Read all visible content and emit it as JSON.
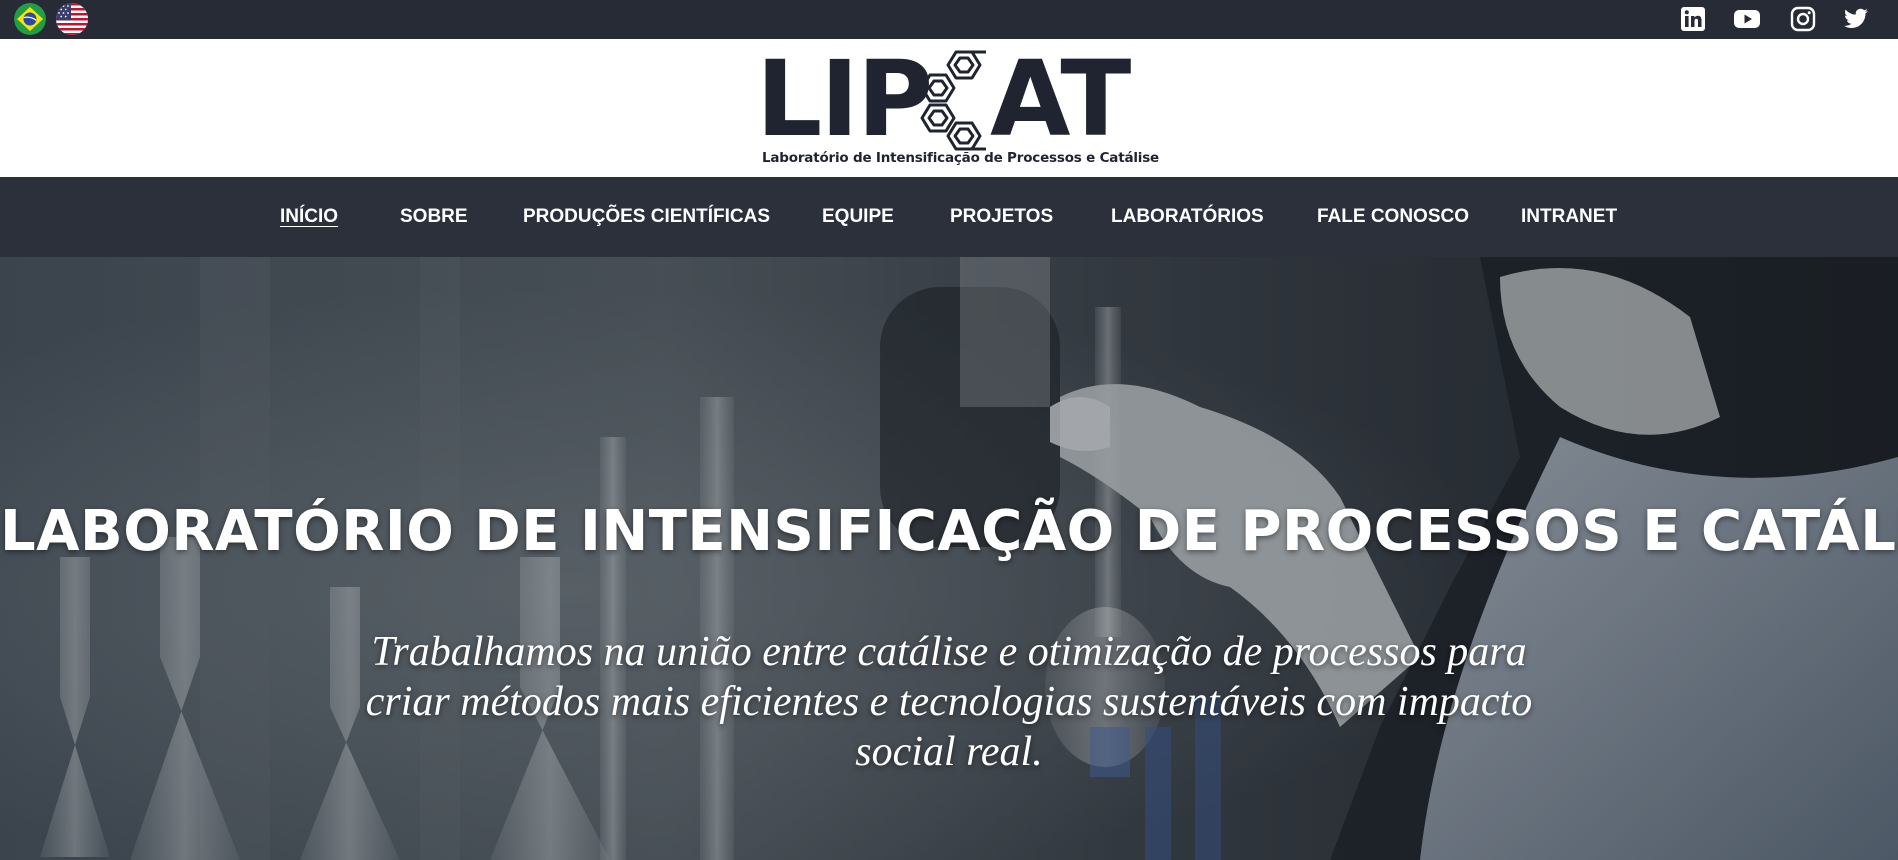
{
  "topbar": {
    "flags": [
      {
        "name": "Português (Brasil)",
        "icon": "brazil-flag-icon"
      },
      {
        "name": "English (US)",
        "icon": "usa-flag-icon"
      }
    ],
    "social": [
      {
        "icon": "linkedin-icon"
      },
      {
        "icon": "youtube-icon"
      },
      {
        "icon": "instagram-icon"
      },
      {
        "icon": "twitter-icon"
      }
    ]
  },
  "logo": {
    "part1": "LIP",
    "part2": "AT",
    "tagline": "Laboratório de Intensificação de Processos e Catálise"
  },
  "nav": {
    "items": [
      {
        "label": "INÍCIO",
        "active": true
      },
      {
        "label": "SOBRE"
      },
      {
        "label": "PRODUÇÕES CIENTÍFICAS"
      },
      {
        "label": "EQUIPE"
      },
      {
        "label": "PROJETOS"
      },
      {
        "label": "LABORATÓRIOS"
      },
      {
        "label": "FALE CONOSCO"
      },
      {
        "label": "INTRANET"
      }
    ]
  },
  "hero": {
    "title": "LABORATÓRIO DE INTENSIFICAÇÃO DE PROCESSOS E CATÁLISE",
    "subtitle": "Trabalhamos na união entre catálise e otimização de processos para criar métodos mais eficientes e tecnologias sustentáveis com impacto social real."
  },
  "colors": {
    "topbar_bg": "#262b36",
    "nav_bg": "#2b303b",
    "logo_text": "#1f2430",
    "text_on_dark": "#ffffff"
  }
}
